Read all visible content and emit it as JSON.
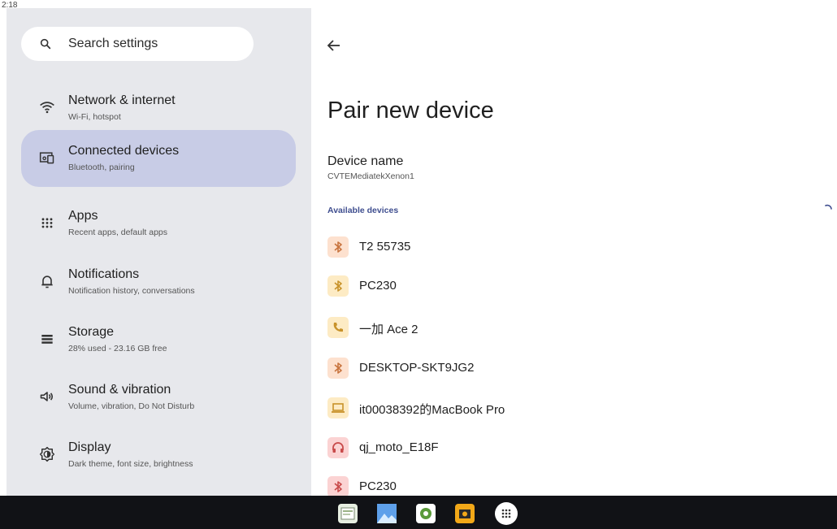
{
  "status_bar": {
    "time": "2:18"
  },
  "search": {
    "placeholder": "Search settings"
  },
  "sidebar": {
    "items": [
      {
        "title": "Network & internet",
        "subtitle": "Wi-Fi, hotspot",
        "icon": "wifi-icon",
        "selected": false
      },
      {
        "title": "Connected devices",
        "subtitle": "Bluetooth, pairing",
        "icon": "connected-devices-icon",
        "selected": true
      },
      {
        "title": "Apps",
        "subtitle": "Recent apps, default apps",
        "icon": "apps-grid-icon",
        "selected": false
      },
      {
        "title": "Notifications",
        "subtitle": "Notification history, conversations",
        "icon": "bell-icon",
        "selected": false
      },
      {
        "title": "Storage",
        "subtitle": "28% used - 23.16 GB free",
        "icon": "storage-icon",
        "selected": false
      },
      {
        "title": "Sound & vibration",
        "subtitle": "Volume, vibration, Do Not Disturb",
        "icon": "speaker-icon",
        "selected": false
      },
      {
        "title": "Display",
        "subtitle": "Dark theme, font size, brightness",
        "icon": "display-icon",
        "selected": false
      }
    ]
  },
  "main": {
    "title": "Pair new device",
    "device_name_label": "Device name",
    "device_name_value": "CVTEMediatekXenon1",
    "section_label": "Available devices",
    "devices": [
      {
        "name": "T2 55735",
        "icon": "bluetooth-icon",
        "badge_color": "#fde1cf",
        "icon_color": "#c8743f"
      },
      {
        "name": "PC230",
        "icon": "bluetooth-icon",
        "badge_color": "#fdebc4",
        "icon_color": "#c8922a"
      },
      {
        "name": "一加 Ace 2",
        "icon": "phone-icon",
        "badge_color": "#fdebc4",
        "icon_color": "#c8922a"
      },
      {
        "name": "DESKTOP-SKT9JG2",
        "icon": "bluetooth-icon",
        "badge_color": "#fde1cf",
        "icon_color": "#c8743f"
      },
      {
        "name": "it00038392的MacBook Pro",
        "icon": "laptop-icon",
        "badge_color": "#fdebc4",
        "icon_color": "#c8922a"
      },
      {
        "name": "qj_moto_E18F",
        "icon": "headphones-icon",
        "badge_color": "#fbd3d3",
        "icon_color": "#c84a4a"
      },
      {
        "name": "PC230",
        "icon": "bluetooth-icon",
        "badge_color": "#fbd3d3",
        "icon_color": "#c84a4a"
      }
    ]
  },
  "taskbar": {
    "apps": [
      {
        "name": "notes-app-icon"
      },
      {
        "name": "gallery-app-icon"
      },
      {
        "name": "settings-app-icon"
      },
      {
        "name": "camera-app-icon"
      },
      {
        "name": "all-apps-icon"
      }
    ]
  }
}
